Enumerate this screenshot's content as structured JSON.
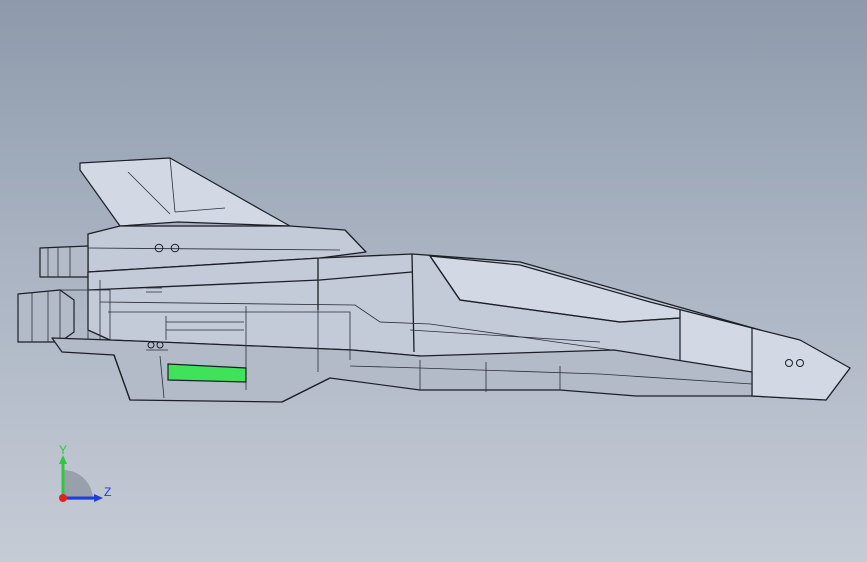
{
  "viewport": {
    "part_highlight_color": "#3ee35a"
  },
  "triad": {
    "y_label": "Y",
    "z_label": "Z",
    "x_color": "#e0241b",
    "y_color": "#2fc83a",
    "z_color": "#1d3fd8"
  }
}
